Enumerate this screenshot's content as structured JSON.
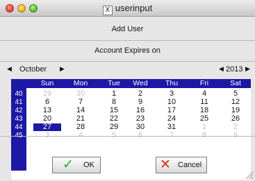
{
  "window": {
    "title": "userinput"
  },
  "header": {
    "title": "Add User"
  },
  "section": {
    "label": "Account Expires on"
  },
  "picker": {
    "month": "October",
    "year": "2013",
    "prev_month_arrow": "◀",
    "next_month_arrow": "▶",
    "prev_year_arrow": "◀",
    "next_year_arrow": "▶"
  },
  "calendar": {
    "days": [
      "Sun",
      "Mon",
      "Tue",
      "Wed",
      "Thu",
      "Fri",
      "Sat"
    ],
    "weeks": [
      {
        "num": "40",
        "days": [
          "29",
          "30",
          "1",
          "2",
          "3",
          "4",
          "5"
        ]
      },
      {
        "num": "41",
        "days": [
          "6",
          "7",
          "8",
          "9",
          "10",
          "11",
          "12"
        ]
      },
      {
        "num": "42",
        "days": [
          "13",
          "14",
          "15",
          "16",
          "17",
          "18",
          "19"
        ]
      },
      {
        "num": "43",
        "days": [
          "20",
          "21",
          "22",
          "23",
          "24",
          "25",
          "26"
        ]
      },
      {
        "num": "44",
        "days": [
          "27",
          "28",
          "29",
          "30",
          "31",
          "1",
          "2"
        ]
      },
      {
        "num": "45",
        "days": [
          "3",
          "4",
          "5",
          "6",
          "7",
          "8",
          "9"
        ]
      }
    ],
    "selected_day": "27",
    "selected_color": "#1e18a6"
  },
  "buttons": {
    "ok_label": "OK",
    "ok_icon": "check-icon",
    "ok_icon_color": "#1fb31f",
    "cancel_label": "Cancel",
    "cancel_icon": "x-icon",
    "cancel_icon_color": "#e0261e"
  }
}
